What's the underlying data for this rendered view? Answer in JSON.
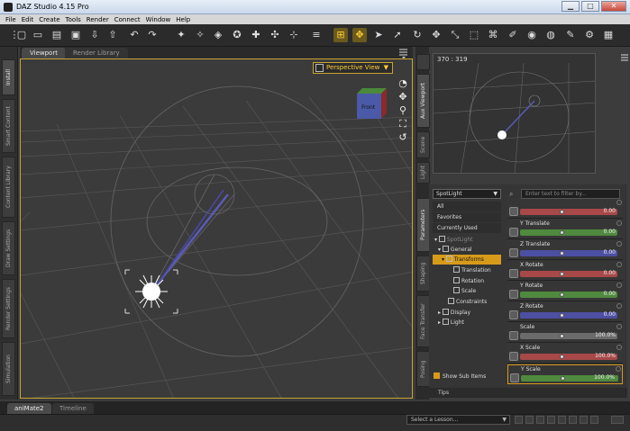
{
  "window": {
    "title": "DAZ Studio 4.15 Pro",
    "min": "▁",
    "max": "□",
    "close": "✕"
  },
  "menu": [
    "File",
    "Edit",
    "Create",
    "Tools",
    "Render",
    "Connect",
    "Window",
    "Help"
  ],
  "toolbar_icons": [
    "new-icon",
    "open-icon",
    "merge-icon",
    "save-icon",
    "import-icon",
    "export-icon",
    "undo-icon",
    "redo-icon",
    "camera-frame-icon",
    "light-pointer-icon",
    "spot-render-icon",
    "dforce-icon",
    "scene-probe-icon",
    "node-select-icon",
    "joint-editor-icon",
    "align-icon",
    "universal-tool-icon",
    "active-pose-icon",
    "pose-tool-icon",
    "node-rotate-icon",
    "translate-icon",
    "rotate-icon",
    "scale-icon",
    "geometry-editor-icon",
    "geometry-sculpt-icon",
    "surface-selection-icon",
    "render-icon",
    "render-settings-icon",
    "render-library-icon",
    "render-toolbar-icon",
    "iray-icon"
  ],
  "left_tabs": [
    "Install",
    "Smart Content",
    "Content Library",
    "Draw Settings",
    "Render Settings",
    "Simulation"
  ],
  "viewport": {
    "tabs": [
      "Viewport",
      "Render Library"
    ],
    "camera": "Perspective View",
    "cube_face": "Front"
  },
  "aux": {
    "coords": "370 : 319",
    "side_tab": "Aux Viewport"
  },
  "right_tabs": [
    "Parameters",
    "Shaping",
    "Face Transfer",
    "Posing"
  ],
  "aux_tabs": [
    "Aux Viewport",
    "Scene",
    "Light"
  ],
  "params": {
    "node": "SpotLight",
    "filter_placeholder": "Enter text to filter by...",
    "tree": {
      "all": "All",
      "favorites": "Favorites",
      "current": "Currently Used",
      "root": "SpotLight",
      "general": "General",
      "transforms": "Transforms",
      "translation": "Translation",
      "rotation": "Rotation",
      "scale": "Scale",
      "constraints": "Constraints",
      "display": "Display",
      "light": "Light"
    },
    "show_sub": "Show Sub Items",
    "items": [
      {
        "label": "",
        "value": "0.00",
        "color": "#a84848"
      },
      {
        "label": "Y Translate",
        "value": "0.00",
        "color": "#4f8a3e"
      },
      {
        "label": "Z Translate",
        "value": "0.00",
        "color": "#4d4fa2"
      },
      {
        "label": "X Rotate",
        "value": "0.00",
        "color": "#a84848"
      },
      {
        "label": "Y Rotate",
        "value": "0.00",
        "color": "#4f8a3e"
      },
      {
        "label": "Z Rotate",
        "value": "0.00",
        "color": "#4d4fa2"
      },
      {
        "label": "Scale",
        "value": "100.0%",
        "color": "#6b6b6b"
      },
      {
        "label": "X Scale",
        "value": "100.0%",
        "color": "#a84848"
      },
      {
        "label": "Y Scale",
        "value": "100.0%",
        "color": "#4f8a3e"
      }
    ]
  },
  "tips": "Tips",
  "bottom_tabs": [
    "aniMate2",
    "Timeline"
  ],
  "lesson": "Select a Lesson..."
}
